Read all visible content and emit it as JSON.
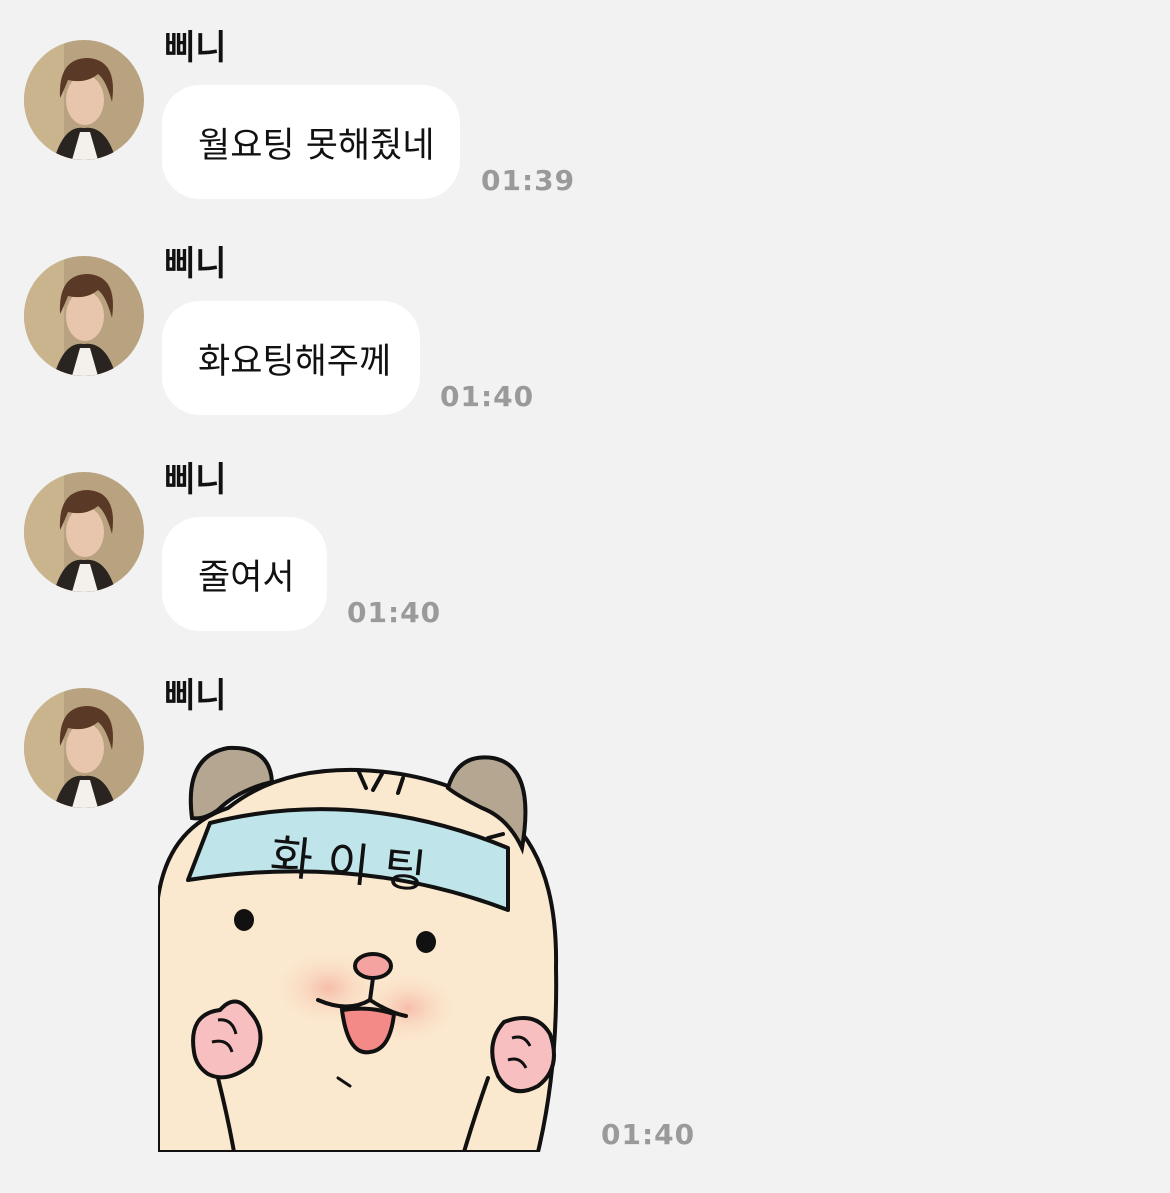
{
  "chat": {
    "messages": [
      {
        "sender": "삐니",
        "text": "월요팅 못해줬네",
        "time": "01:39"
      },
      {
        "sender": "삐니",
        "text": "화요팅해주께",
        "time": "01:40"
      },
      {
        "sender": "삐니",
        "text": "줄여서",
        "time": "01:40"
      },
      {
        "sender": "삐니",
        "sticker_text": "화 이 팅",
        "time": "01:40"
      }
    ]
  },
  "colors": {
    "background": "#f2f2f2",
    "bubble": "#ffffff",
    "timestamp": "#9a9a9a",
    "sticker_body": "#fbe9cf",
    "sticker_headband": "#bfe5ea"
  }
}
